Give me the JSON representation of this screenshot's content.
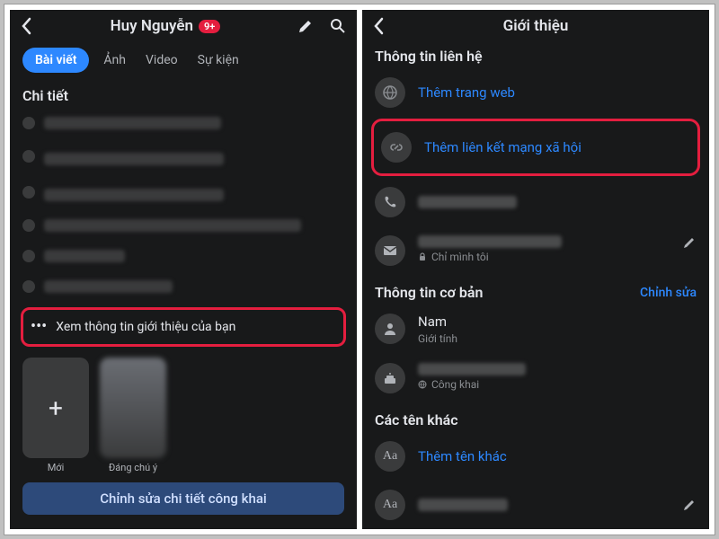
{
  "left": {
    "header": {
      "title": "Huy Nguyễn",
      "badge": "9+"
    },
    "tabs": {
      "active": "Bài viết",
      "items": [
        "Ảnh",
        "Video",
        "Sự kiện"
      ]
    },
    "details_title": "Chi tiết",
    "see_about": "Xem thông tin giới thiệu của bạn",
    "stories": {
      "new": "Mới",
      "featured": "Đáng chú ý"
    },
    "edit_public": "Chỉnh sửa chi tiết công khai"
  },
  "right": {
    "header": "Giới thiệu",
    "contact_title": "Thông tin liên hệ",
    "add_website": "Thêm trang web",
    "add_social": "Thêm liên kết mạng xã hội",
    "only_me": "Chỉ mình tôi",
    "basic_title": "Thông tin cơ bản",
    "edit": "Chỉnh sửa",
    "gender_value": "Nam",
    "gender_label": "Giới tính",
    "public": "Công khai",
    "other_names_title": "Các tên khác",
    "add_other_name": "Thêm tên khác"
  }
}
